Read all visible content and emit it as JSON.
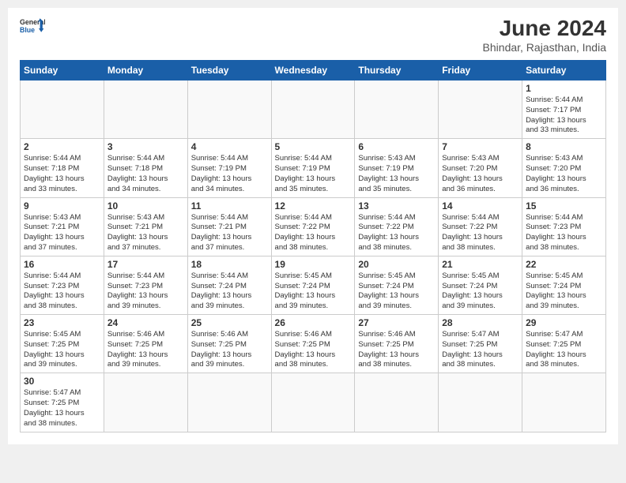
{
  "header": {
    "logo_general": "General",
    "logo_blue": "Blue",
    "title": "June 2024",
    "subtitle": "Bhindar, Rajasthan, India"
  },
  "weekdays": [
    "Sunday",
    "Monday",
    "Tuesday",
    "Wednesday",
    "Thursday",
    "Friday",
    "Saturday"
  ],
  "days": {
    "1": {
      "sunrise": "5:44 AM",
      "sunset": "7:17 PM",
      "daylight": "13 hours and 33 minutes."
    },
    "2": {
      "sunrise": "5:44 AM",
      "sunset": "7:18 PM",
      "daylight": "13 hours and 33 minutes."
    },
    "3": {
      "sunrise": "5:44 AM",
      "sunset": "7:18 PM",
      "daylight": "13 hours and 34 minutes."
    },
    "4": {
      "sunrise": "5:44 AM",
      "sunset": "7:19 PM",
      "daylight": "13 hours and 34 minutes."
    },
    "5": {
      "sunrise": "5:44 AM",
      "sunset": "7:19 PM",
      "daylight": "13 hours and 35 minutes."
    },
    "6": {
      "sunrise": "5:43 AM",
      "sunset": "7:19 PM",
      "daylight": "13 hours and 35 minutes."
    },
    "7": {
      "sunrise": "5:43 AM",
      "sunset": "7:20 PM",
      "daylight": "13 hours and 36 minutes."
    },
    "8": {
      "sunrise": "5:43 AM",
      "sunset": "7:20 PM",
      "daylight": "13 hours and 36 minutes."
    },
    "9": {
      "sunrise": "5:43 AM",
      "sunset": "7:21 PM",
      "daylight": "13 hours and 37 minutes."
    },
    "10": {
      "sunrise": "5:43 AM",
      "sunset": "7:21 PM",
      "daylight": "13 hours and 37 minutes."
    },
    "11": {
      "sunrise": "5:44 AM",
      "sunset": "7:21 PM",
      "daylight": "13 hours and 37 minutes."
    },
    "12": {
      "sunrise": "5:44 AM",
      "sunset": "7:22 PM",
      "daylight": "13 hours and 38 minutes."
    },
    "13": {
      "sunrise": "5:44 AM",
      "sunset": "7:22 PM",
      "daylight": "13 hours and 38 minutes."
    },
    "14": {
      "sunrise": "5:44 AM",
      "sunset": "7:22 PM",
      "daylight": "13 hours and 38 minutes."
    },
    "15": {
      "sunrise": "5:44 AM",
      "sunset": "7:23 PM",
      "daylight": "13 hours and 38 minutes."
    },
    "16": {
      "sunrise": "5:44 AM",
      "sunset": "7:23 PM",
      "daylight": "13 hours and 38 minutes."
    },
    "17": {
      "sunrise": "5:44 AM",
      "sunset": "7:23 PM",
      "daylight": "13 hours and 39 minutes."
    },
    "18": {
      "sunrise": "5:44 AM",
      "sunset": "7:24 PM",
      "daylight": "13 hours and 39 minutes."
    },
    "19": {
      "sunrise": "5:45 AM",
      "sunset": "7:24 PM",
      "daylight": "13 hours and 39 minutes."
    },
    "20": {
      "sunrise": "5:45 AM",
      "sunset": "7:24 PM",
      "daylight": "13 hours and 39 minutes."
    },
    "21": {
      "sunrise": "5:45 AM",
      "sunset": "7:24 PM",
      "daylight": "13 hours and 39 minutes."
    },
    "22": {
      "sunrise": "5:45 AM",
      "sunset": "7:24 PM",
      "daylight": "13 hours and 39 minutes."
    },
    "23": {
      "sunrise": "5:45 AM",
      "sunset": "7:25 PM",
      "daylight": "13 hours and 39 minutes."
    },
    "24": {
      "sunrise": "5:46 AM",
      "sunset": "7:25 PM",
      "daylight": "13 hours and 39 minutes."
    },
    "25": {
      "sunrise": "5:46 AM",
      "sunset": "7:25 PM",
      "daylight": "13 hours and 39 minutes."
    },
    "26": {
      "sunrise": "5:46 AM",
      "sunset": "7:25 PM",
      "daylight": "13 hours and 38 minutes."
    },
    "27": {
      "sunrise": "5:46 AM",
      "sunset": "7:25 PM",
      "daylight": "13 hours and 38 minutes."
    },
    "28": {
      "sunrise": "5:47 AM",
      "sunset": "7:25 PM",
      "daylight": "13 hours and 38 minutes."
    },
    "29": {
      "sunrise": "5:47 AM",
      "sunset": "7:25 PM",
      "daylight": "13 hours and 38 minutes."
    },
    "30": {
      "sunrise": "5:47 AM",
      "sunset": "7:25 PM",
      "daylight": "13 hours and 38 minutes."
    }
  },
  "labels": {
    "sunrise": "Sunrise:",
    "sunset": "Sunset:",
    "daylight": "Daylight:"
  }
}
